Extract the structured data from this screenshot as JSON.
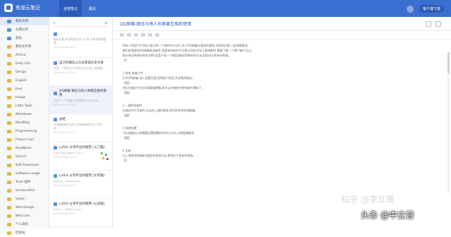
{
  "app": {
    "title": "有道云笔记"
  },
  "top_tabs": [
    {
      "label": "全部笔记",
      "active": true
    },
    {
      "label": "最近"
    }
  ],
  "top_right": {
    "button": "客户端下载"
  },
  "sidebar": {
    "items": [
      {
        "label": "最新文档",
        "active": true,
        "icon": "doc-icon"
      },
      {
        "label": "与我分享",
        "icon": "share-icon"
      },
      {
        "label": "星标",
        "icon": "star-icon"
      },
      {
        "label": "我的文件夹",
        "icon": "folder-icon"
      },
      {
        "label": "Article",
        "icon": "folder-icon"
      },
      {
        "label": "Daily LOL",
        "icon": "folder-icon"
      },
      {
        "label": "Design",
        "icon": "folder-icon"
      },
      {
        "label": "English",
        "icon": "folder-icon"
      },
      {
        "label": "Java",
        "icon": "folder-icon"
      },
      {
        "label": "Image",
        "icon": "folder-icon"
      },
      {
        "label": "Little Tools",
        "icon": "folder-icon"
      },
      {
        "label": "Markdown",
        "icon": "folder-icon"
      },
      {
        "label": "MindMap",
        "icon": "folder-icon"
      },
      {
        "label": "Programming",
        "icon": "folder-icon"
      },
      {
        "label": "Project Lion",
        "icon": "folder-icon"
      },
      {
        "label": "ReadBook",
        "icon": "folder-icon"
      },
      {
        "label": "Search",
        "icon": "folder-icon"
      },
      {
        "label": "Soft Download",
        "icon": "folder-icon"
      },
      {
        "label": "Software usage",
        "icon": "folder-icon"
      },
      {
        "label": "Tools 插件",
        "icon": "folder-icon"
      },
      {
        "label": "Unclassified",
        "icon": "folder-icon"
      },
      {
        "label": "Video",
        "icon": "folder-icon"
      },
      {
        "label": "Web Design",
        "icon": "folder-icon"
      },
      {
        "label": "Web Lien",
        "icon": "folder-icon"
      },
      {
        "label": "个人资料",
        "icon": "folder-icon"
      },
      {
        "label": "回收站",
        "icon": "trash-icon"
      }
    ]
  },
  "notes": [
    {
      "title": "…",
      "snippet": "做有价值,有用的笔记学习记录,方便查看和整理",
      "date": "2019-05-06 15:10"
    },
    {
      "title": "自己的微信公众号获取历史文章",
      "snippet": "这是一个微信公众号的方法,利用工具获取...",
      "date": "2019-04-23 15:37"
    },
    {
      "title": "QQ邮箱-微信与他人邮箱互相的使用",
      "snippet": "在这个一个问题,大家想到有什么办法...",
      "date": "2019-04-17 16:02",
      "active": true
    },
    {
      "title": "总结",
      "snippet": "QQ邮箱微信与他人的邮箱使用方法,大家一起...",
      "date": "2019-04-12 10:22"
    },
    {
      "title": "LaTeX 分享平台的使用 [入门篇]",
      "snippet": "http://nlp.sogou.com/...",
      "date": "2019-04-08 11:20"
    },
    {
      "title": "LaTeX 分享平台的使用 [文字篇]",
      "snippet": "http://... weibo.com/...",
      "date": "2019-04-05 19:42"
    },
    {
      "title": "LaTeX 分享平台的使用 [公式篇]",
      "snippet": "http://... weibo.com/...",
      "date": "2019-03-28 09:15"
    }
  ],
  "editor": {
    "title": "QQ邮箱-微信与他人的邮箱互相的使用",
    "paragraphs": [
      "你好,大家好!今天给大家分享一个邮件的小技巧,关于QQ邮箱与微信的使用,非常的方便,一起来看看吧。",
      "我们经常使用QQ邮箱发送邮件,但是有时候并不方便,比如在手机上接收邮件,需要下载一个客户端才可以。",
      "那么有没有更好的办法呢?这里介绍一个微信接收QQ邮件的方法,相信对大家有所帮助。",
      "【】",
      "",
      "1 首先,准备工作",
      "打开QQ邮箱,进入设置页面,找到账户选项,开启相关服务。",
      "【图】",
      "然后在微信中关注QQ邮箱提醒,就可以在微信中收到邮件通知了。",
      "【图】",
      "",
      "2 一键转发邮件",
      "在微信中打开邮件,点击右上角的按钮,即可转发到其他邮箱。",
      "【图】",
      "",
      "3 其他设置",
      "可以根据自己的需要设置提醒的时间与方式,方便管理邮件。",
      "【图】",
      "",
      "4 总结",
      "以上就是QQ邮箱与微信的使用方法,希望对大家有所帮助。",
      "【】"
    ]
  },
  "watermarks": [
    "知乎 @李立骞",
    "头条 @中立普"
  ]
}
